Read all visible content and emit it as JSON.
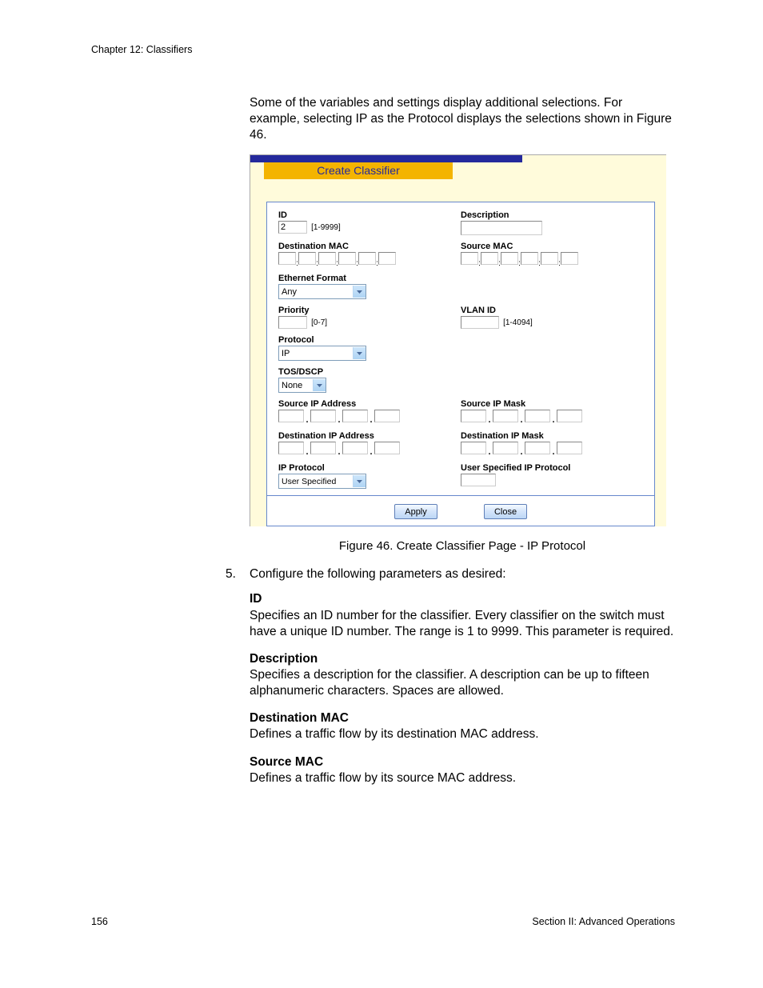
{
  "header": {
    "chapter": "Chapter 12: Classifiers"
  },
  "intro": "Some of the variables and settings display additional selections. For example, selecting IP as the Protocol displays the selections shown in Figure 46.",
  "panel": {
    "title": "Create Classifier",
    "id": {
      "label": "ID",
      "value": "2",
      "range": "[1-9999]"
    },
    "description": {
      "label": "Description",
      "value": ""
    },
    "dest_mac": {
      "label": "Destination MAC"
    },
    "src_mac": {
      "label": "Source MAC"
    },
    "eth_format": {
      "label": "Ethernet Format",
      "value": "Any"
    },
    "priority": {
      "label": "Priority",
      "range": "[0-7]",
      "value": ""
    },
    "vlan": {
      "label": "VLAN ID",
      "range": "[1-4094]",
      "value": ""
    },
    "protocol": {
      "label": "Protocol",
      "value": "IP"
    },
    "tos": {
      "label": "TOS/DSCP",
      "value": "None"
    },
    "src_ip": {
      "label": "Source IP Address"
    },
    "src_mask": {
      "label": "Source IP Mask"
    },
    "dst_ip": {
      "label": "Destination IP Address"
    },
    "dst_mask": {
      "label": "Destination IP Mask"
    },
    "ip_proto": {
      "label": "IP Protocol",
      "value": "User Specified"
    },
    "user_ip_proto": {
      "label": "User Specified IP Protocol",
      "value": ""
    },
    "apply_btn": "Apply",
    "close_btn": "Close"
  },
  "caption": "Figure 46. Create Classifier Page - IP Protocol",
  "step5": {
    "num": "5.",
    "text": "Configure the following parameters as desired:"
  },
  "params": {
    "id": {
      "title": "ID",
      "text": "Specifies an ID number for the classifier. Every classifier on the switch must have a unique ID number. The range is 1 to 9999. This parameter is required."
    },
    "desc": {
      "title": "Description",
      "text": "Specifies a description for the classifier. A description can be up to fifteen alphanumeric characters. Spaces are allowed."
    },
    "dmac": {
      "title": "Destination MAC",
      "text": "Defines a traffic flow by its destination MAC address."
    },
    "smac": {
      "title": "Source MAC",
      "text": "Defines a traffic flow by its source MAC address."
    }
  },
  "footer": {
    "page": "156",
    "section": "Section II: Advanced Operations"
  }
}
